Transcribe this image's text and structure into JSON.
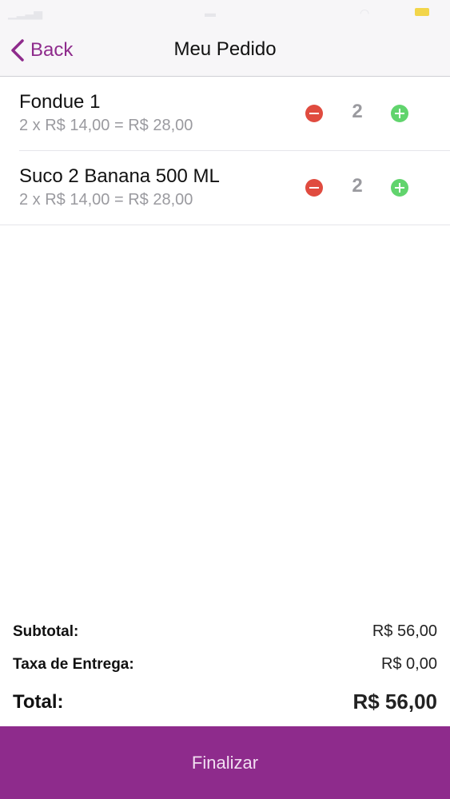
{
  "nav": {
    "back_label": "Back",
    "title": "Meu Pedido"
  },
  "items": [
    {
      "name": "Fondue 1",
      "price_line": "2 x R$ 14,00 = R$ 28,00",
      "quantity": "2"
    },
    {
      "name": "Suco 2 Banana 500 ML",
      "price_line": "2 x R$ 14,00 = R$ 28,00",
      "quantity": "2"
    }
  ],
  "summary": {
    "subtotal_label": "Subtotal:",
    "subtotal_value": "R$ 56,00",
    "delivery_label": "Taxa de Entrega:",
    "delivery_value": "R$ 0,00",
    "total_label": "Total:",
    "total_value": "R$ 56,00"
  },
  "footer": {
    "finalize_label": "Finalizar"
  },
  "colors": {
    "accent": "#8e2b8c",
    "minus": "#e04b3f",
    "plus": "#61d46d"
  }
}
